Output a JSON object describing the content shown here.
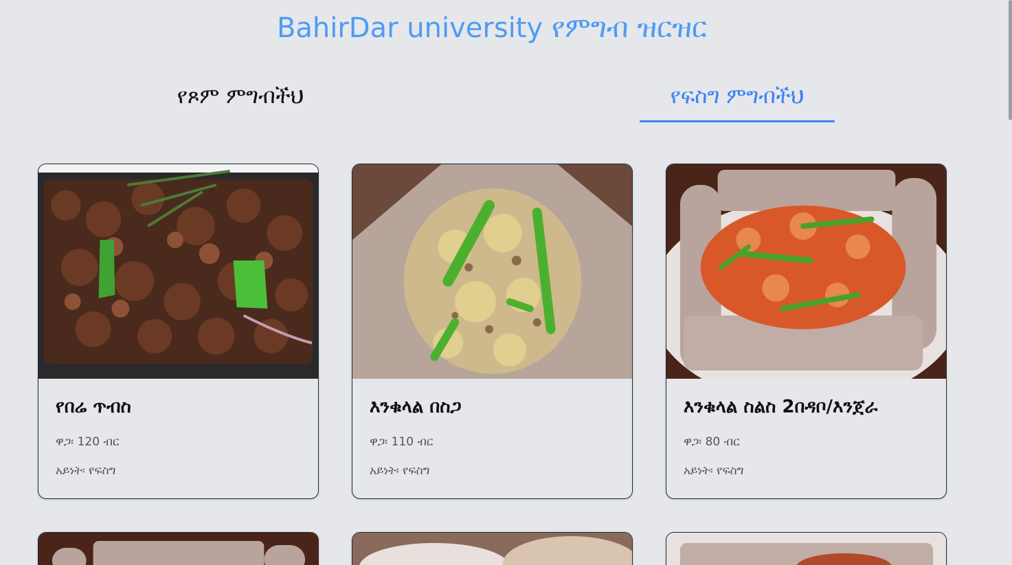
{
  "header": {
    "title": "BahirDar university የምግብ ዝርዝር"
  },
  "tabs": [
    {
      "label": "የጾም ምግብችህ",
      "active": false
    },
    {
      "label": "የፍስግ ምግብችህ",
      "active": true
    }
  ],
  "cards": [
    {
      "name": "የበሬ ጥብስ",
      "price": "ዋጋ፡ 120 ብር",
      "type": "አይነት፡ የፍስግ"
    },
    {
      "name": "እንቁላል በስጋ",
      "price": "ዋጋ፡ 110 ብር",
      "type": "አይነት፡ የፍስግ"
    },
    {
      "name": "እንቁላል ስልስ 2በዳቦ/እንጀራ",
      "price": "ዋጋ፡ 80 ብር",
      "type": "አይነት፡ የፍስግ"
    }
  ],
  "colors": {
    "accent": "#3b82f6",
    "title": "#4f9bf3",
    "background": "#e5e7eb"
  }
}
